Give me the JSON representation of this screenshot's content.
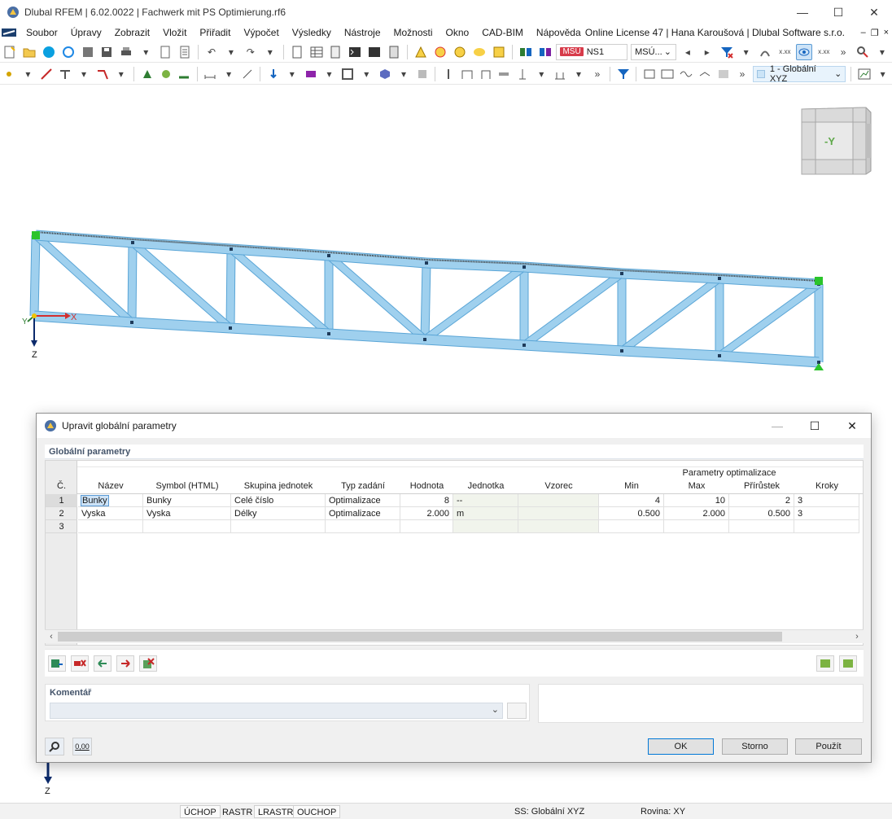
{
  "window": {
    "title": "Dlubal RFEM | 6.02.0022 | Fachwerk mit PS Optimierung.rf6"
  },
  "menu": {
    "items": [
      "Soubor",
      "Úpravy",
      "Zobrazit",
      "Vložit",
      "Přiřadit",
      "Výpočet",
      "Výsledky",
      "Nástroje",
      "Možnosti",
      "Okno",
      "CAD-BIM",
      "Nápověda"
    ],
    "license": "Online License 47 | Hana Karoušová | Dlubal Software s.r.o."
  },
  "toolbar": {
    "msu_tag": "MSÚ",
    "load_case": "NS1",
    "msu_combo": "MSÚ...",
    "view_combo": "1 - Globální XYZ"
  },
  "viewport": {
    "axis_x": "X",
    "axis_y": "Y",
    "axis_z": "Z",
    "axis_z2": "Z",
    "navcube_label": "-Y"
  },
  "dialog": {
    "title": "Upravit globální parametry",
    "group_title": "Globální parametry",
    "columns": {
      "no": "Č.",
      "name": "Název",
      "symbol": "Symbol (HTML)",
      "unit_group": "Skupina jednotek",
      "input_type": "Typ zadání",
      "value": "Hodnota",
      "unit": "Jednotka",
      "formula": "Vzorec",
      "opt_group": "Parametry optimalizace",
      "min": "Min",
      "max": "Max",
      "step": "Přírůstek",
      "steps": "Kroky"
    },
    "rows": [
      {
        "no": "1",
        "name": "Bunky",
        "symbol": "Bunky",
        "unit_group": "Celé číslo",
        "input_type": "Optimalizace",
        "value": "8",
        "unit": "--",
        "formula": "",
        "min": "4",
        "max": "10",
        "step": "2",
        "steps": "3"
      },
      {
        "no": "2",
        "name": "Vyska",
        "symbol": "Vyska",
        "unit_group": "Délky",
        "input_type": "Optimalizace",
        "value": "2.000",
        "unit": "m",
        "formula": "",
        "min": "0.500",
        "max": "2.000",
        "step": "0.500",
        "steps": "3"
      },
      {
        "no": "3",
        "name": "",
        "symbol": "",
        "unit_group": "",
        "input_type": "",
        "value": "",
        "unit": "",
        "formula": "",
        "min": "",
        "max": "",
        "step": "",
        "steps": ""
      }
    ],
    "comment_label": "Komentář",
    "comment_value": "",
    "zero_button": "0,00",
    "ok": "OK",
    "cancel": "Storno",
    "apply": "Použít"
  },
  "statusbar": {
    "toggles": [
      "ÚCHOP",
      "RASTR",
      "LRASTR",
      "OUCHOP"
    ],
    "coord_system": "SS: Globální XYZ",
    "plane": "Rovina: XY"
  },
  "colors": {
    "member": "#9fd0ee",
    "member_edge": "#5aa5d6",
    "accent": "#0078d7",
    "msu_tag": "#d73b4a"
  }
}
